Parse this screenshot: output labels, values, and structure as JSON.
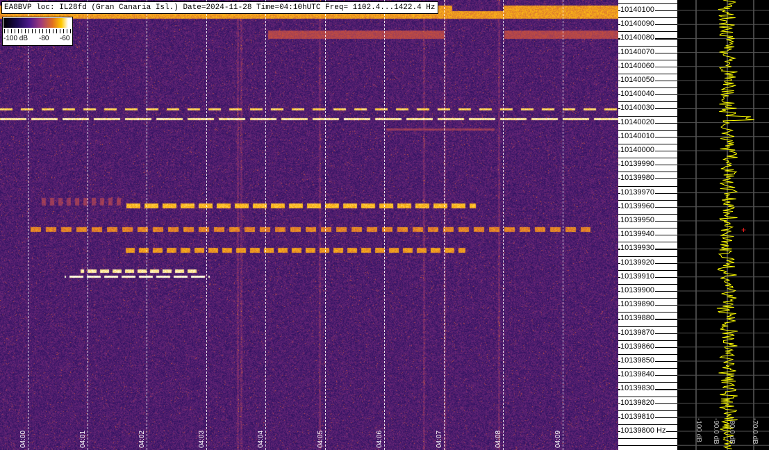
{
  "header": {
    "title": "EA8BVP loc: IL28fd (Gran Canaria Isl.) Date=2024-11-28 Time=04:10hUTC Freq= 1102.4...1422.4 Hz"
  },
  "legend": {
    "labels": [
      "-100 dB",
      "-80",
      "-60"
    ]
  },
  "time_labels": [
    "04:00",
    "04:01",
    "04:02",
    "04:03",
    "04:04",
    "04:05",
    "04:06",
    "04:07",
    "04:08",
    "04:09"
  ],
  "freq_labels": [
    "10140100",
    "10140090",
    "10140080",
    "10140070",
    "10140060",
    "10140050",
    "10140040",
    "10140030",
    "10140020",
    "10140010",
    "10140000",
    "10139990",
    "10139980",
    "10139970",
    "10139960",
    "10139950",
    "10139940",
    "10139930",
    "10139920",
    "10139910",
    "10139900",
    "10139890",
    "10139880",
    "10139870",
    "10139860",
    "10139850",
    "10139840",
    "10139830",
    "10139820",
    "10139810",
    "10139800 Hz"
  ],
  "power_labels": [
    "-100 dB",
    "-90.0 dB",
    "-80.0 dB",
    "-70.0 dB"
  ],
  "colors": {
    "trace": "#ffff00",
    "marker": "#ff2020",
    "grid": "#888888"
  }
}
